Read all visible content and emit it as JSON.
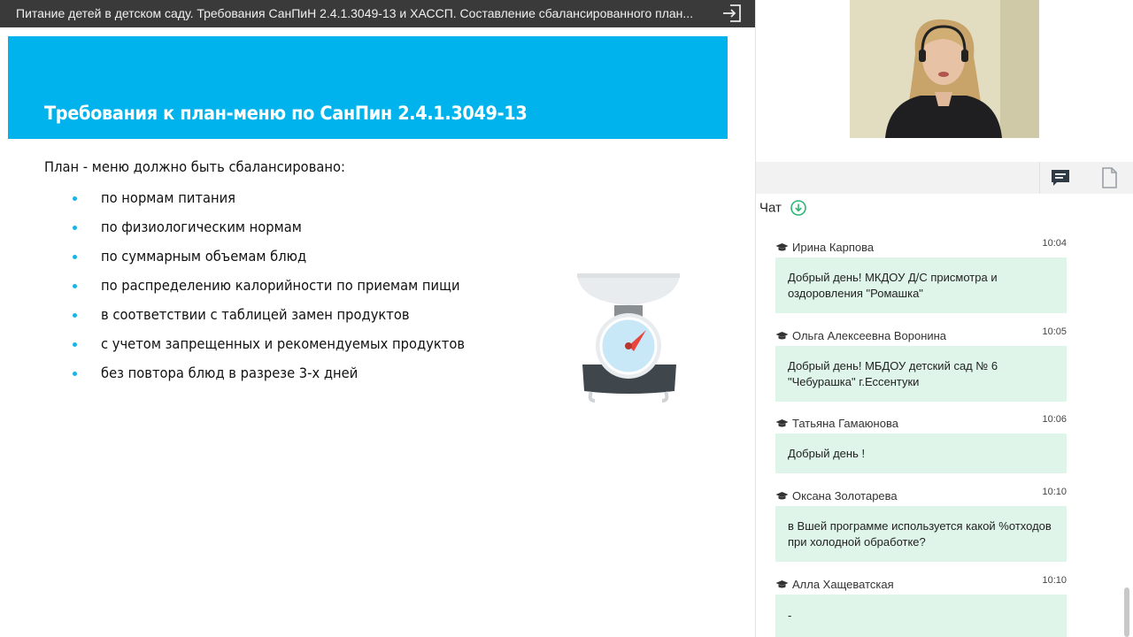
{
  "window": {
    "title": "Питание детей в детском саду. Требования СанПиН 2.4.1.3049-13 и ХАССП. Составление сбалансированного план..."
  },
  "slide": {
    "heading": "Требования к план-меню по СанПин 2.4.1.3049-13",
    "lead": "План - меню должно быть сбалансировано:",
    "bullets": [
      "по нормам питания",
      "по физиологическим нормам",
      "по суммарным объемам блюд",
      "по распределению калорийности по приемам пищи",
      "в соответствии с  таблицей замен продуктов",
      "с учетом запрещенных и рекомендуемых продуктов",
      "без повтора блюд в разрезе 3-х дней"
    ],
    "colors": {
      "header_bg": "#00b3ec",
      "bullet": "#18b4e6"
    },
    "illustration": "kitchen-scale-icon"
  },
  "panel": {
    "tabs": [
      {
        "icon": "chat-icon",
        "active": true
      },
      {
        "icon": "document-icon",
        "active": false
      }
    ],
    "chat_title": "Чат",
    "chat_title_icon": "download-circle-icon",
    "messages": [
      {
        "author": "Ирина Карпова",
        "time": "10:04",
        "text_lines": [
          "Добрый день! МКДОУ Д/С присмотра и",
          "оздоровления \"Ромашка\""
        ]
      },
      {
        "author": "Ольга Алексеевна Воронина",
        "time": "10:05",
        "text_lines": [
          "Добрый день! МБДОУ детский сад № 6",
          "\"Чебурашка\" г.Ессентуки"
        ]
      },
      {
        "author": "Татьяна Гамаюнова",
        "time": "10:06",
        "text_lines": [
          "Добрый день !"
        ]
      },
      {
        "author": "Оксана Золотарева",
        "time": "10:10",
        "text_lines": [
          "в Вшей программе используется какой %отходов",
          "при холодной обработке?"
        ]
      },
      {
        "author": "Алла Хащеватская",
        "time": "10:10",
        "text_lines": [
          "-"
        ]
      }
    ],
    "colors": {
      "bubble_bg": "#dff5ea",
      "accent_green": "#2bb673"
    }
  }
}
